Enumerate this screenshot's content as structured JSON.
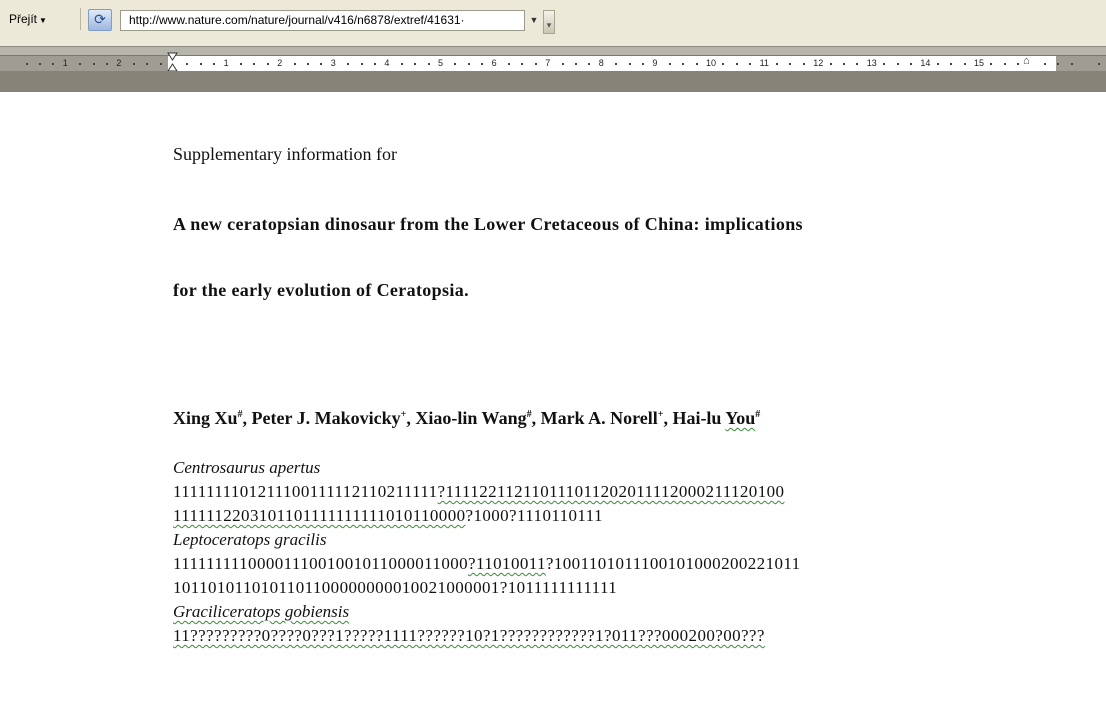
{
  "toolbar": {
    "goto_label": "Přejít",
    "url": "http://www.nature.com/nature/journal/v416/n6878/extref/41631·"
  },
  "ruler": {
    "numbers_left": [
      "2",
      "1"
    ],
    "numbers_right": [
      "1",
      "2",
      "3",
      "4",
      "5",
      "6",
      "7",
      "8",
      "9",
      "10",
      "11",
      "12",
      "13",
      "14",
      "15"
    ]
  },
  "document": {
    "intro": "Supplementary information for",
    "title_line1": "A new ceratopsian dinosaur from the Lower Cretaceous of China: implications",
    "title_line2": "for the early evolution of Ceratopsia.",
    "authors": [
      {
        "name": "Xing Xu",
        "mark": "#",
        "after": ", "
      },
      {
        "name": "Peter J. Makovicky",
        "mark": "+",
        "after": ", "
      },
      {
        "name": "Xiao-lin Wang",
        "mark": "#",
        "after": ", "
      },
      {
        "name": "Mark A. Norell",
        "mark": "+",
        "after": ", "
      },
      {
        "name": "Hai-lu ",
        "name2": "You",
        "mark": "#",
        "after": ""
      }
    ],
    "taxa": [
      {
        "name": "Centrosaurus apertus",
        "line1_plain": "1111111101211100111112110211111",
        "line1_flag": "?111122112110111011202011112000211120100",
        "line2_flag": "1111112203101101111111111010110000",
        "line2_plain": "?1000?1110110111"
      },
      {
        "name": "Leptoceratops gracilis",
        "line1_plain": "1111111110000111001001011000011000",
        "line1_flag": "?11010011",
        "line1_rest": "?1001101011100101000200221011",
        "line2_plain": "1011010110101101100000000010021000001?1011111111111"
      },
      {
        "name": "Graciliceratops gobiensis",
        "line1_flag": "11?????????0????0???1?????1111??????10?1????????????1?011???000200?00???"
      }
    ]
  },
  "colors": {
    "toolbar_bg": "#ece9d8",
    "ruler_dark": "#868478",
    "grammar_underline": "#3b8a3b",
    "spelling_underline": "#c0392b"
  }
}
